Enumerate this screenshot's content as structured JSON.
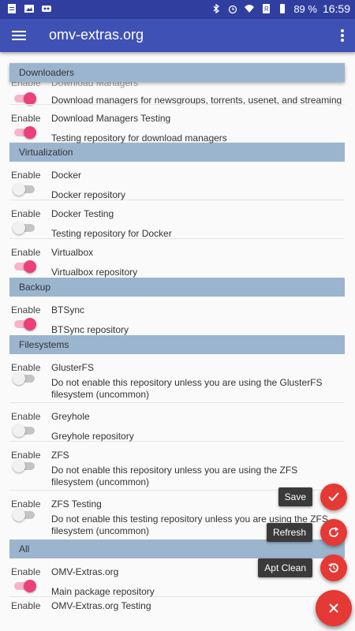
{
  "status_bar": {
    "battery": "89 %",
    "time": "16:59"
  },
  "app_bar": {
    "title": "omv-extras.org"
  },
  "enable_label": "Enable",
  "sections": [
    {
      "title": "Downloaders",
      "partial_top": "Download Managers",
      "repos": [
        {
          "name": "",
          "desc": "Download managers for newsgroups, torrents, usenet, and streaming",
          "enabled": true,
          "partial": true
        },
        {
          "name": "Download Managers Testing",
          "desc": "Testing repository for download managers",
          "enabled": true
        }
      ]
    },
    {
      "title": "Virtualization",
      "repos": [
        {
          "name": "Docker",
          "desc": "Docker repository",
          "enabled": false
        },
        {
          "name": "Docker Testing",
          "desc": "Testing repository for Docker",
          "enabled": false
        },
        {
          "name": "Virtualbox",
          "desc": "Virtualbox repository",
          "enabled": true
        }
      ]
    },
    {
      "title": "Backup",
      "repos": [
        {
          "name": "BTSync",
          "desc": "BTSync repository",
          "enabled": true
        }
      ]
    },
    {
      "title": "Filesystems",
      "repos": [
        {
          "name": "GlusterFS",
          "desc": "Do not enable this repository unless you are using the GlusterFS filesystem (uncommon)",
          "enabled": false
        },
        {
          "name": "Greyhole",
          "desc": "Greyhole repository",
          "enabled": false
        },
        {
          "name": "ZFS",
          "desc": "Do not enable this repository unless you are using the ZFS filesystem (uncommon)",
          "enabled": false
        },
        {
          "name": "ZFS Testing",
          "desc": "Do not enable this testing repository unless you are using the ZFS filesystem (uncommon)",
          "enabled": false
        }
      ]
    },
    {
      "title": "All",
      "repos": [
        {
          "name": "OMV-Extras.org",
          "desc": "Main package repository",
          "enabled": true
        }
      ]
    }
  ],
  "partial_bottom": "OMV-Extras.org Testing",
  "fab_actions": {
    "save": "Save",
    "refresh": "Refresh",
    "apt_clean": "Apt Clean"
  },
  "colors": {
    "primary": "#3f51b5",
    "primary_dark": "#303f9f",
    "section": "#9bb5cf",
    "accent": "#ec407a",
    "fab": "#e53935"
  }
}
